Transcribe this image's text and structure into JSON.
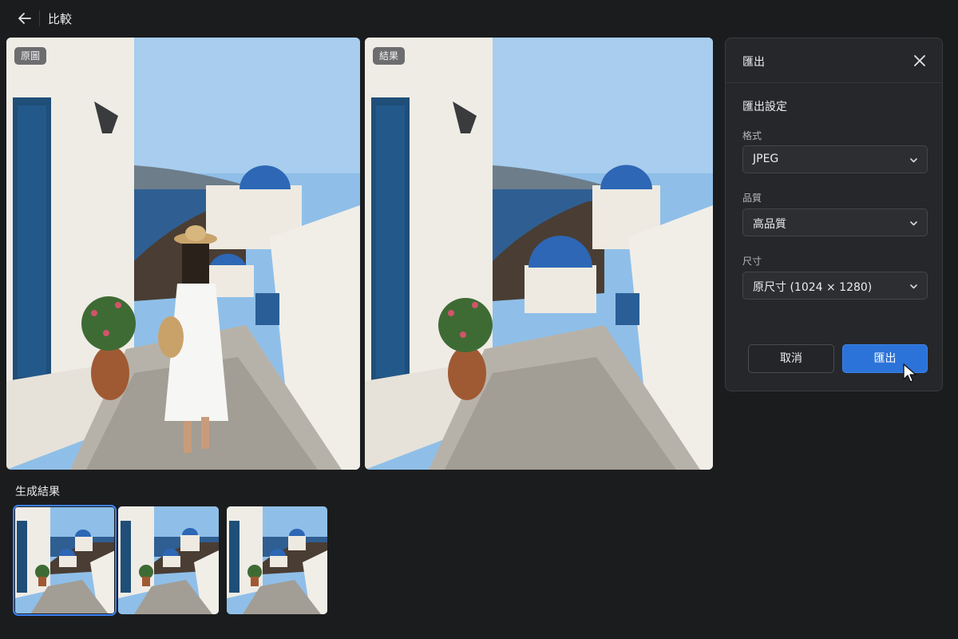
{
  "header": {
    "back_icon": "arrow-left-icon",
    "title": "比較"
  },
  "panels": {
    "original_badge": "原圖",
    "result_badge": "結果"
  },
  "export_dialog": {
    "title": "匯出",
    "close_icon": "close-icon",
    "section_title": "匯出設定",
    "format": {
      "label": "格式",
      "value": "JPEG"
    },
    "quality": {
      "label": "品質",
      "value": "高品質"
    },
    "size": {
      "label": "尺寸",
      "value": "原尺寸 (1024 × 1280)"
    },
    "cancel_label": "取消",
    "export_label": "匯出",
    "accent_color": "#2c73d9"
  },
  "results": {
    "label": "生成結果",
    "thumbnails": [
      {
        "selected": true
      },
      {
        "selected": false
      },
      {
        "selected": false
      }
    ]
  }
}
